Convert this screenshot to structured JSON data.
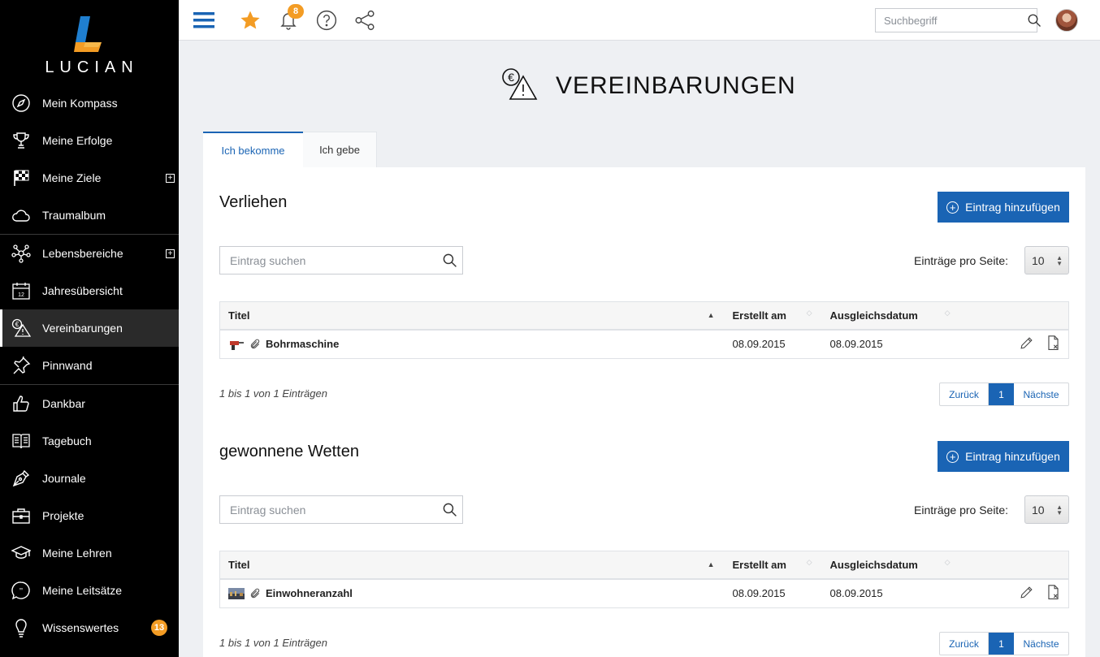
{
  "sidebar": {
    "logo_text": "LUCIAN",
    "groups": [
      [
        {
          "label": "Mein Kompass",
          "icon": "compass-icon"
        },
        {
          "label": "Meine Erfolge",
          "icon": "trophy-icon"
        },
        {
          "label": "Meine Ziele",
          "icon": "checkered-flag-icon",
          "expandable": true
        },
        {
          "label": "Traumalbum",
          "icon": "cloud-icon"
        }
      ],
      [
        {
          "label": "Lebensbereiche",
          "icon": "network-icon",
          "expandable": true
        },
        {
          "label": "Jahresübersicht",
          "icon": "calendar-icon"
        },
        {
          "label": "Vereinbarungen",
          "icon": "euro-warning-icon",
          "active": true
        },
        {
          "label": "Pinnwand",
          "icon": "pushpin-icon"
        }
      ],
      [
        {
          "label": "Dankbar",
          "icon": "thumbs-up-icon"
        },
        {
          "label": "Tagebuch",
          "icon": "book-icon"
        },
        {
          "label": "Journale",
          "icon": "pen-nib-icon"
        },
        {
          "label": "Projekte",
          "icon": "briefcase-icon"
        },
        {
          "label": "Meine Lehren",
          "icon": "graduation-cap-icon"
        },
        {
          "label": "Meine Leitsätze",
          "icon": "quote-bubble-icon"
        },
        {
          "label": "Wissenswertes",
          "icon": "lightbulb-icon",
          "count": "13"
        }
      ]
    ]
  },
  "topbar": {
    "notifications_count": "8",
    "search_placeholder": "Suchbegriff"
  },
  "page": {
    "title": "VEREINBARUNGEN",
    "tabs": [
      {
        "label": "Ich bekomme",
        "active": true
      },
      {
        "label": "Ich gebe",
        "active": false
      }
    ]
  },
  "sections": [
    {
      "heading": "Verliehen",
      "add_label": "Eintrag hinzufügen",
      "search_placeholder": "Eintrag suchen",
      "per_page_label": "Einträge pro Seite:",
      "per_page_value": "10",
      "columns": [
        "Titel",
        "Erstellt am",
        "Ausgleichsdatum"
      ],
      "rows": [
        {
          "title": "Bohrmaschine",
          "thumbnail": "drill-thumbnail",
          "created": "08.09.2015",
          "settlement": "08.09.2015"
        }
      ],
      "info": "1 bis 1 von 1 Einträgen",
      "pager": {
        "prev": "Zurück",
        "current": "1",
        "next": "Nächste"
      }
    },
    {
      "heading": "gewonnene Wetten",
      "add_label": "Eintrag hinzufügen",
      "search_placeholder": "Eintrag suchen",
      "per_page_label": "Einträge pro Seite:",
      "per_page_value": "10",
      "columns": [
        "Titel",
        "Erstellt am",
        "Ausgleichsdatum"
      ],
      "rows": [
        {
          "title": "Einwohneranzahl",
          "thumbnail": "city-thumbnail",
          "created": "08.09.2015",
          "settlement": "08.09.2015"
        }
      ],
      "info": "1 bis 1 von 1 Einträgen",
      "pager": {
        "prev": "Zurück",
        "current": "1",
        "next": "Nächste"
      }
    }
  ],
  "colors": {
    "primary": "#1a64b4",
    "accent": "#f39c24",
    "sidebar_bg": "#000000"
  }
}
